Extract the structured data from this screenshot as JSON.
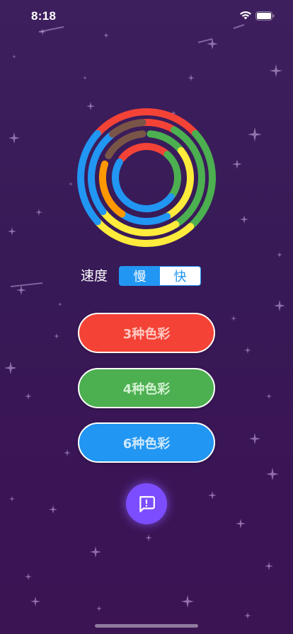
{
  "status_bar": {
    "time": "8:18",
    "icons": [
      "wifi-icon",
      "battery-icon"
    ]
  },
  "logo": {
    "icon": "concentric-color-rings",
    "colors": [
      "#f44336",
      "#4caf50",
      "#ffeb3b",
      "#2196f3",
      "#795548",
      "#ff9800"
    ]
  },
  "speed": {
    "label": "速度",
    "options": [
      "慢",
      "快"
    ],
    "selected": "慢"
  },
  "modes": {
    "three_colors": "3种色彩",
    "four_colors": "4种色彩",
    "six_colors": "6种色彩"
  },
  "feedback": {
    "icon": "feedback-icon"
  },
  "colors": {
    "background_top": "#3e1f5e",
    "background_bottom": "#3b1453",
    "red": "#f44336",
    "green": "#4caf50",
    "blue": "#2196f3",
    "accent_purple": "#7c4dff"
  }
}
